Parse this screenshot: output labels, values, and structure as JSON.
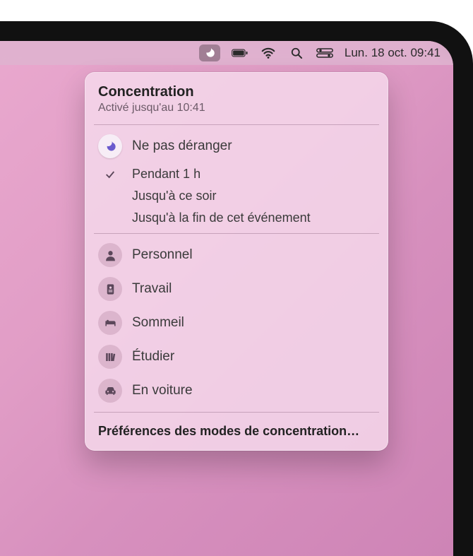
{
  "menubar": {
    "date_time": "Lun. 18 oct.  09:41"
  },
  "panel": {
    "title": "Concentration",
    "subtitle": "Activé jusqu'au 10:41",
    "dnd": {
      "label": "Ne pas déranger",
      "options": [
        {
          "label": "Pendant 1 h",
          "selected": true
        },
        {
          "label": "Jusqu'à ce soir",
          "selected": false
        },
        {
          "label": "Jusqu'à la fin de cet événement",
          "selected": false
        }
      ]
    },
    "modes": [
      {
        "icon": "person",
        "label": "Personnel"
      },
      {
        "icon": "badge",
        "label": "Travail"
      },
      {
        "icon": "bed",
        "label": "Sommeil"
      },
      {
        "icon": "books",
        "label": "Étudier"
      },
      {
        "icon": "car",
        "label": "En voiture"
      }
    ],
    "footer": "Préférences des modes de concentration…"
  }
}
